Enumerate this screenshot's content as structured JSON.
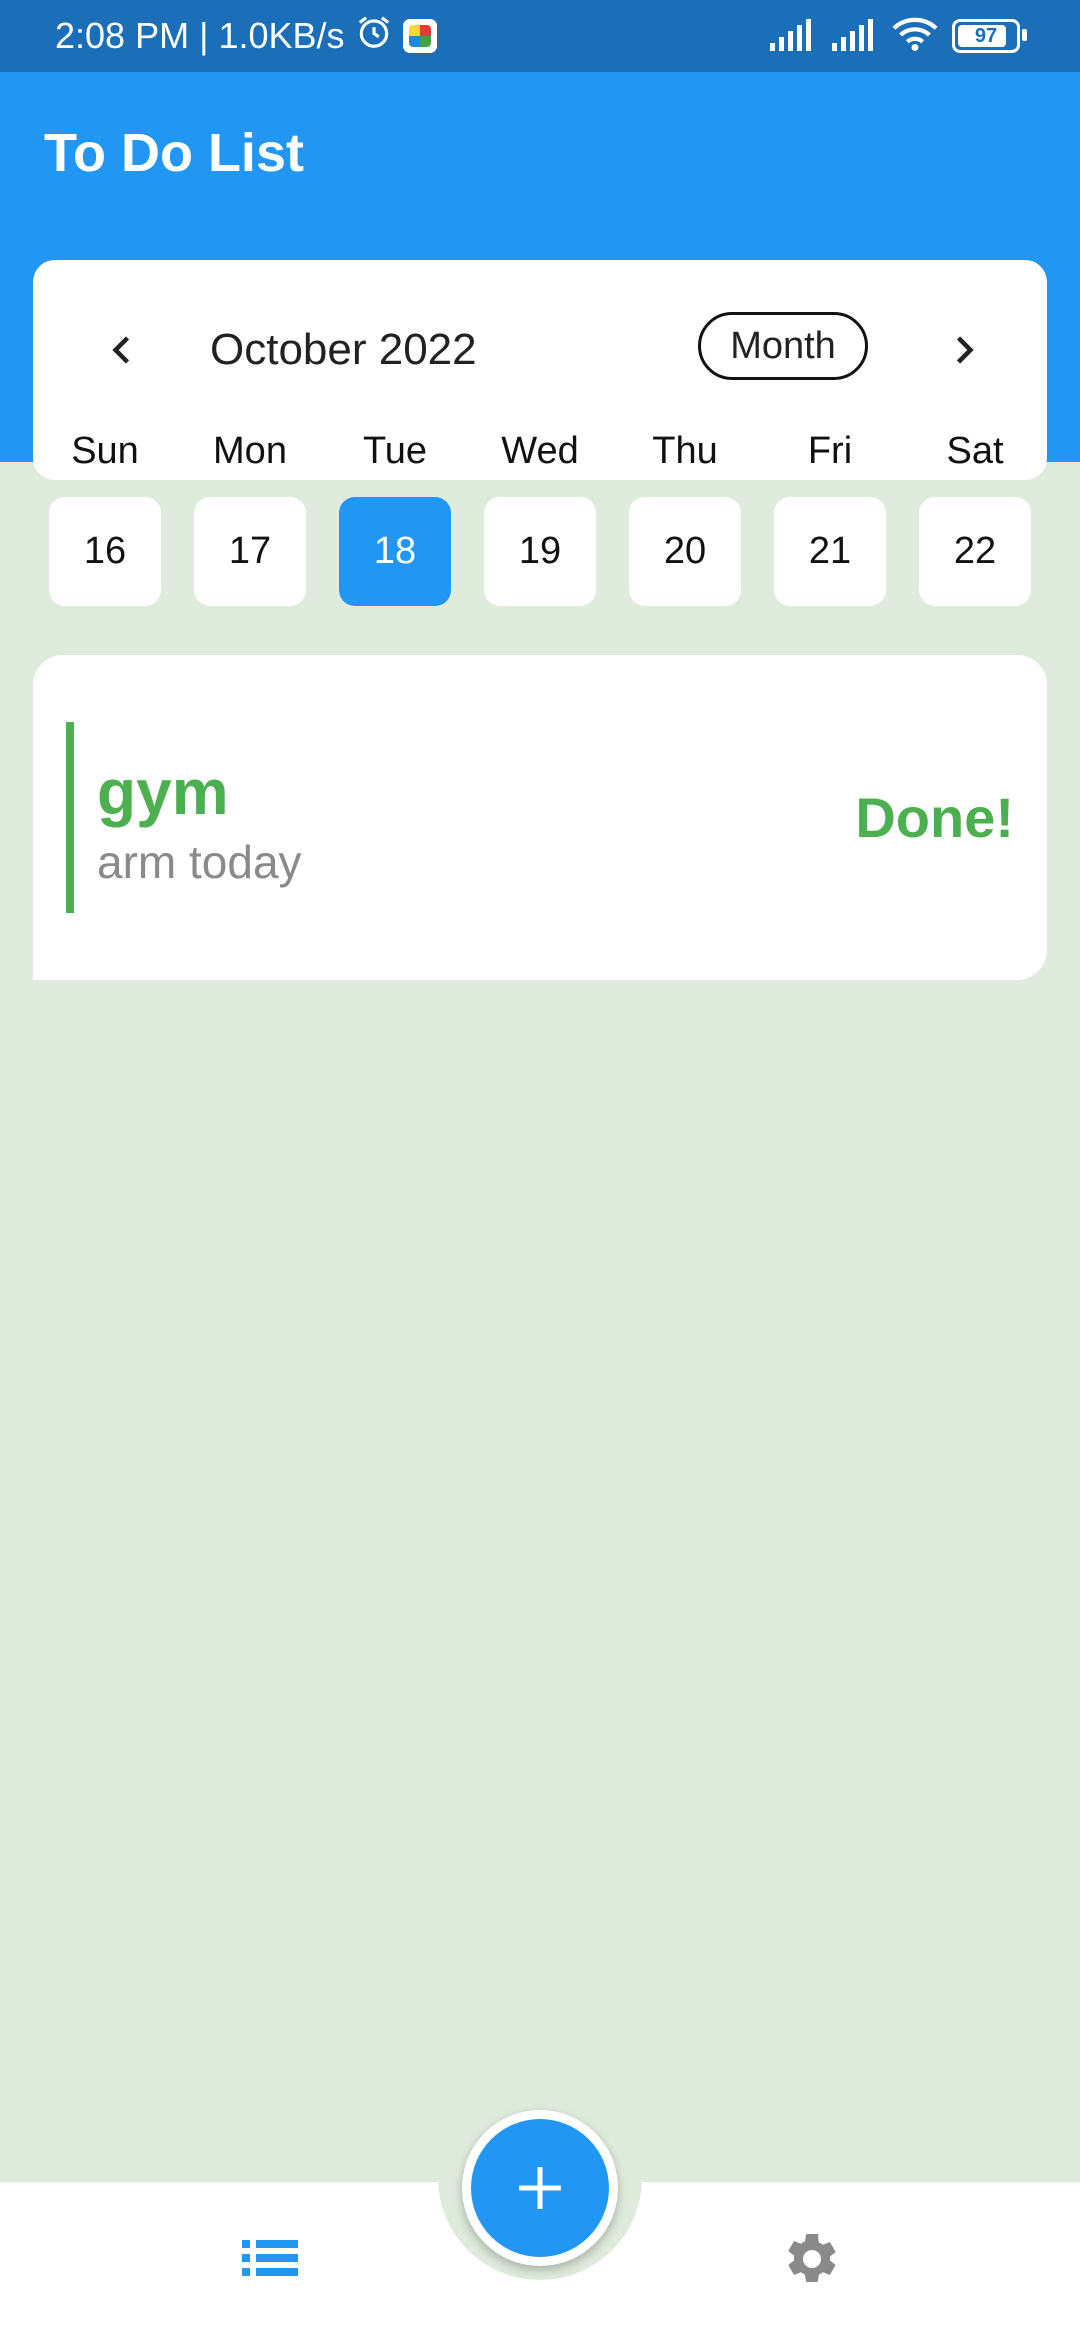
{
  "status_bar": {
    "time": "2:08 PM",
    "separator": "|",
    "net_speed": "1.0KB/s",
    "battery": "97",
    "icons": [
      "alarm-icon",
      "app-notification-icon",
      "signal-icon",
      "signal-icon",
      "wifi-icon",
      "battery-icon"
    ]
  },
  "app": {
    "title": "To Do List",
    "colors": {
      "primary": "#2196F3",
      "accent_done": "#4CAF50",
      "background": "#DFEBDD"
    }
  },
  "calendar": {
    "month_label": "October 2022",
    "format_button": "Month",
    "weekdays": [
      "Sun",
      "Mon",
      "Tue",
      "Wed",
      "Thu",
      "Fri",
      "Sat"
    ],
    "days": [
      "16",
      "17",
      "18",
      "19",
      "20",
      "21",
      "22"
    ],
    "selected_day": "18"
  },
  "tasks": [
    {
      "title": "gym",
      "subtitle": "arm today",
      "status": "Done!"
    }
  ],
  "bottom_nav": {
    "items": [
      "list-icon",
      "add-icon",
      "settings-icon"
    ]
  }
}
